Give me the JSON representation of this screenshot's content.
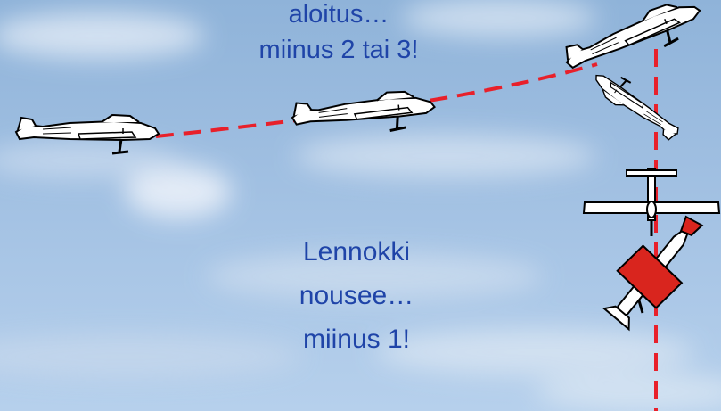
{
  "captions": {
    "top": [
      "aloitus…",
      "miinus 2 tai 3!"
    ],
    "middle": [
      "Lennokki",
      "nousee…",
      "miinus 1!"
    ]
  },
  "colors": {
    "text": "#1f44a8",
    "path": "#e8202a",
    "plane_body": "#ffffff",
    "plane_outline": "#000000",
    "highlight_plane": "#d9251e"
  },
  "icons": [
    "airplane-icon"
  ]
}
